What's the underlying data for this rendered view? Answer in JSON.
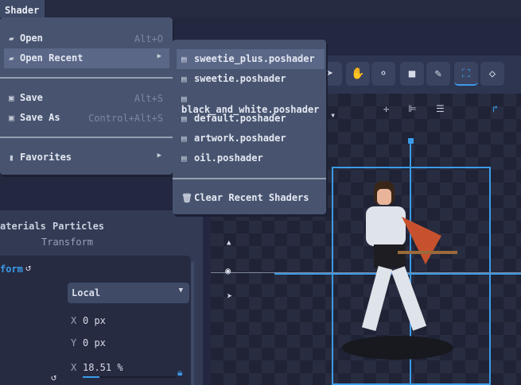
{
  "menubar": {
    "active_menu": "Shader"
  },
  "shader_menu": {
    "items": [
      {
        "label": "Open",
        "shortcut": "Alt+O",
        "icon": "folder-open-icon"
      },
      {
        "label": "Open Recent",
        "icon": "folder-recent-icon",
        "submenu": true,
        "highlighted": true
      },
      {
        "label": "Save",
        "shortcut": "Alt+S",
        "icon": "save-icon"
      },
      {
        "label": "Save As",
        "shortcut": "Control+Alt+S",
        "icon": "save-as-icon"
      },
      {
        "label": "Favorites",
        "icon": "bookmark-icon",
        "submenu": true
      }
    ]
  },
  "recent_submenu": {
    "items": [
      "sweetie_plus.poshader",
      "sweetie.poshader",
      "black_and_white.poshader",
      "default.poshader",
      "artwork.poshader",
      "oil.poshader"
    ],
    "clear_label": "Clear Recent Shaders"
  },
  "left_panel": {
    "tabs": [
      "aterials",
      "Particles"
    ],
    "section_title": "Transform",
    "group_label": "form",
    "space_select": "Local",
    "position_x": "0 px",
    "position_y": "0 px",
    "axis_x": "X",
    "axis_y": "Y",
    "scale_x": "18.51 %",
    "scale_fraction": 0.18
  },
  "colors": {
    "accent": "#3b9be8",
    "menu_bg": "#48546f",
    "highlight": "#5a6787"
  }
}
